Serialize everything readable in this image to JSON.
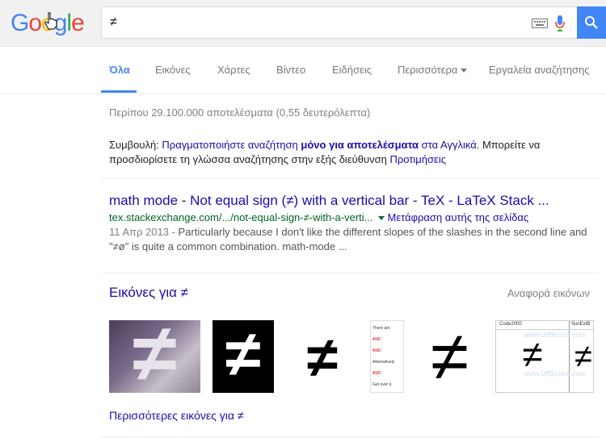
{
  "logo": {
    "letters": [
      "G",
      "o",
      "o",
      "g",
      "l",
      "e"
    ],
    "colors": [
      "#4285f4",
      "#ea4335",
      "#fbbc05",
      "#4285f4",
      "#34a853",
      "#ea4335"
    ]
  },
  "search": {
    "query": "≠"
  },
  "tabs": [
    {
      "label": "Όλα",
      "active": true
    },
    {
      "label": "Εικόνες"
    },
    {
      "label": "Χάρτες"
    },
    {
      "label": "Βίντεο"
    },
    {
      "label": "Ειδήσεις"
    },
    {
      "label": "Περισσότερα"
    },
    {
      "label": "Εργαλεία αναζήτησης"
    }
  ],
  "stats": "Περίπου 29.100.000 αποτελέσματα (0,55 δευτερόλεπτα)",
  "tip": {
    "prefix": "Συμβουλή: ",
    "link1": "Πραγματοποιήστε αναζήτηση ",
    "bold": "μόνο για αποτελέσματα",
    "link1b": " στα Αγγλικά",
    "mid": ". Μπορείτε να προσδιορίσετε τη γλώσσα αναζήτησης στην εξής διεύθυνση ",
    "link2": "Προτιμήσεις"
  },
  "result": {
    "title": "math mode - Not equal sign (≠) with a vertical bar - TeX - LaTeX Stack ...",
    "url": "tex.stackexchange.com/.../not-equal-sign-≠-with-a-verti...",
    "translate": "Μετάφραση αυτής της σελίδας",
    "date": "11 Απρ 2013 - ",
    "snippet1": "Particularly because I don't like the different slopes of the slashes in the second line and",
    "snippet2": "\"≠ø\" is quite a common combination. math-mode ..."
  },
  "images": {
    "heading": "Εικόνες για ≠",
    "report": "Αναφορά εικόνων",
    "more": "Περισσότερες εικόνες για ≠",
    "thumbs": [
      {
        "glyph": "≠",
        "name": "thumb-gradient"
      },
      {
        "glyph": "≠",
        "name": "thumb-black"
      },
      {
        "glyph": "≠",
        "name": "thumb-bold"
      },
      {
        "glyph": "",
        "name": "thumb-comic",
        "lines": [
          "There are",
          "AND",
          "AND",
          "Alternatively",
          "AND",
          "Get over it."
        ]
      },
      {
        "glyph": "≠",
        "name": "thumb-thin"
      },
      {
        "glyph": "≠",
        "name": "thumb-table",
        "labels": [
          "Code2000",
          "SunExtB"
        ],
        "watermark": "www.utf8icons.com"
      }
    ]
  }
}
